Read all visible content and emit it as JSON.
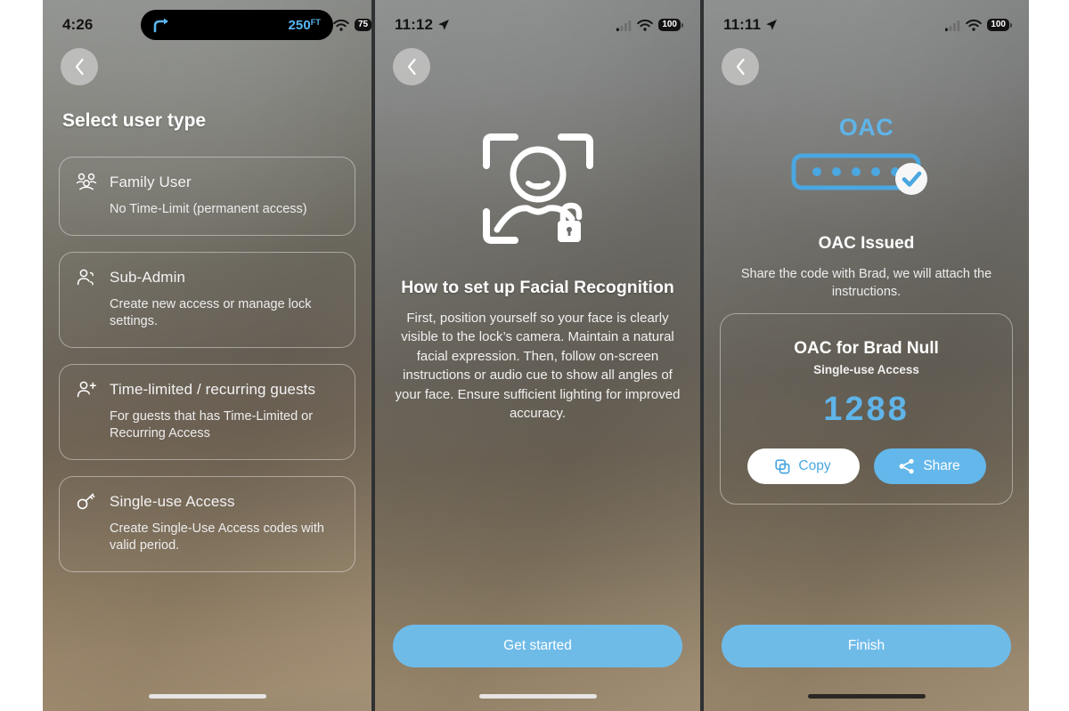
{
  "panels": [
    {
      "id": "select-user-type",
      "status": {
        "time": "4:26",
        "nav_pill": {
          "distance": "250",
          "unit": "FT",
          "icon": "turn-right-arrow-icon"
        },
        "wifi": "wifi-icon",
        "battery": "75"
      },
      "back_label": "‹",
      "title": "Select user type",
      "cards": [
        {
          "icon": "family-group-icon",
          "title": "Family User",
          "subtitle": "No Time-Limit (permanent access)"
        },
        {
          "icon": "person-gear-icon",
          "title": "Sub-Admin",
          "subtitle": "Create new access or manage lock settings."
        },
        {
          "icon": "person-plus-icon",
          "title": "Time-limited / recurring guests",
          "subtitle": "For guests that has Time-Limited or Recurring Access"
        },
        {
          "icon": "key-icon",
          "title": "Single-use Access",
          "subtitle": "Create Single-Use Access codes with valid period."
        }
      ]
    },
    {
      "id": "facial-recognition-setup",
      "status": {
        "time": "11:12",
        "location_arrow": "location-arrow-icon",
        "cellular": "cellular-bars-icon",
        "wifi": "wifi-icon",
        "battery": "100"
      },
      "back_label": "‹",
      "hero_icon": "face-id-unlock-icon",
      "title": "How to set up Facial Recognition",
      "body": "First, position yourself so your face is clearly visible to the lock’s camera. Maintain a natural facial expression. Then, follow on-screen instructions or audio cue to show all angles of your face. Ensure sufficient lighting for improved accuracy.",
      "cta": "Get started"
    },
    {
      "id": "oac-issued",
      "status": {
        "time": "11:11",
        "location_arrow": "location-arrow-icon",
        "cellular": "cellular-bars-icon",
        "wifi": "wifi-icon",
        "battery": "100"
      },
      "back_label": "‹",
      "brand": "OAC",
      "brand_icon": "passcode-verified-icon",
      "heading": "OAC Issued",
      "note": "Share the code with Brad, we will attach the instructions.",
      "card": {
        "title": "OAC for Brad Null",
        "type": "Single-use Access",
        "code": "1288",
        "copy_label": "Copy",
        "copy_icon": "copy-icon",
        "share_label": "Share",
        "share_icon": "share-nodes-icon"
      },
      "cta": "Finish"
    }
  ],
  "colors": {
    "accent_blue": "#63b7ea",
    "code_blue": "#5fb4e8",
    "cta_blue": "#6fbbe8",
    "copy_blue": "#4aa8e0",
    "card_border": "rgba(255,255,255,0.42)",
    "text_primary": "#ffffff"
  }
}
